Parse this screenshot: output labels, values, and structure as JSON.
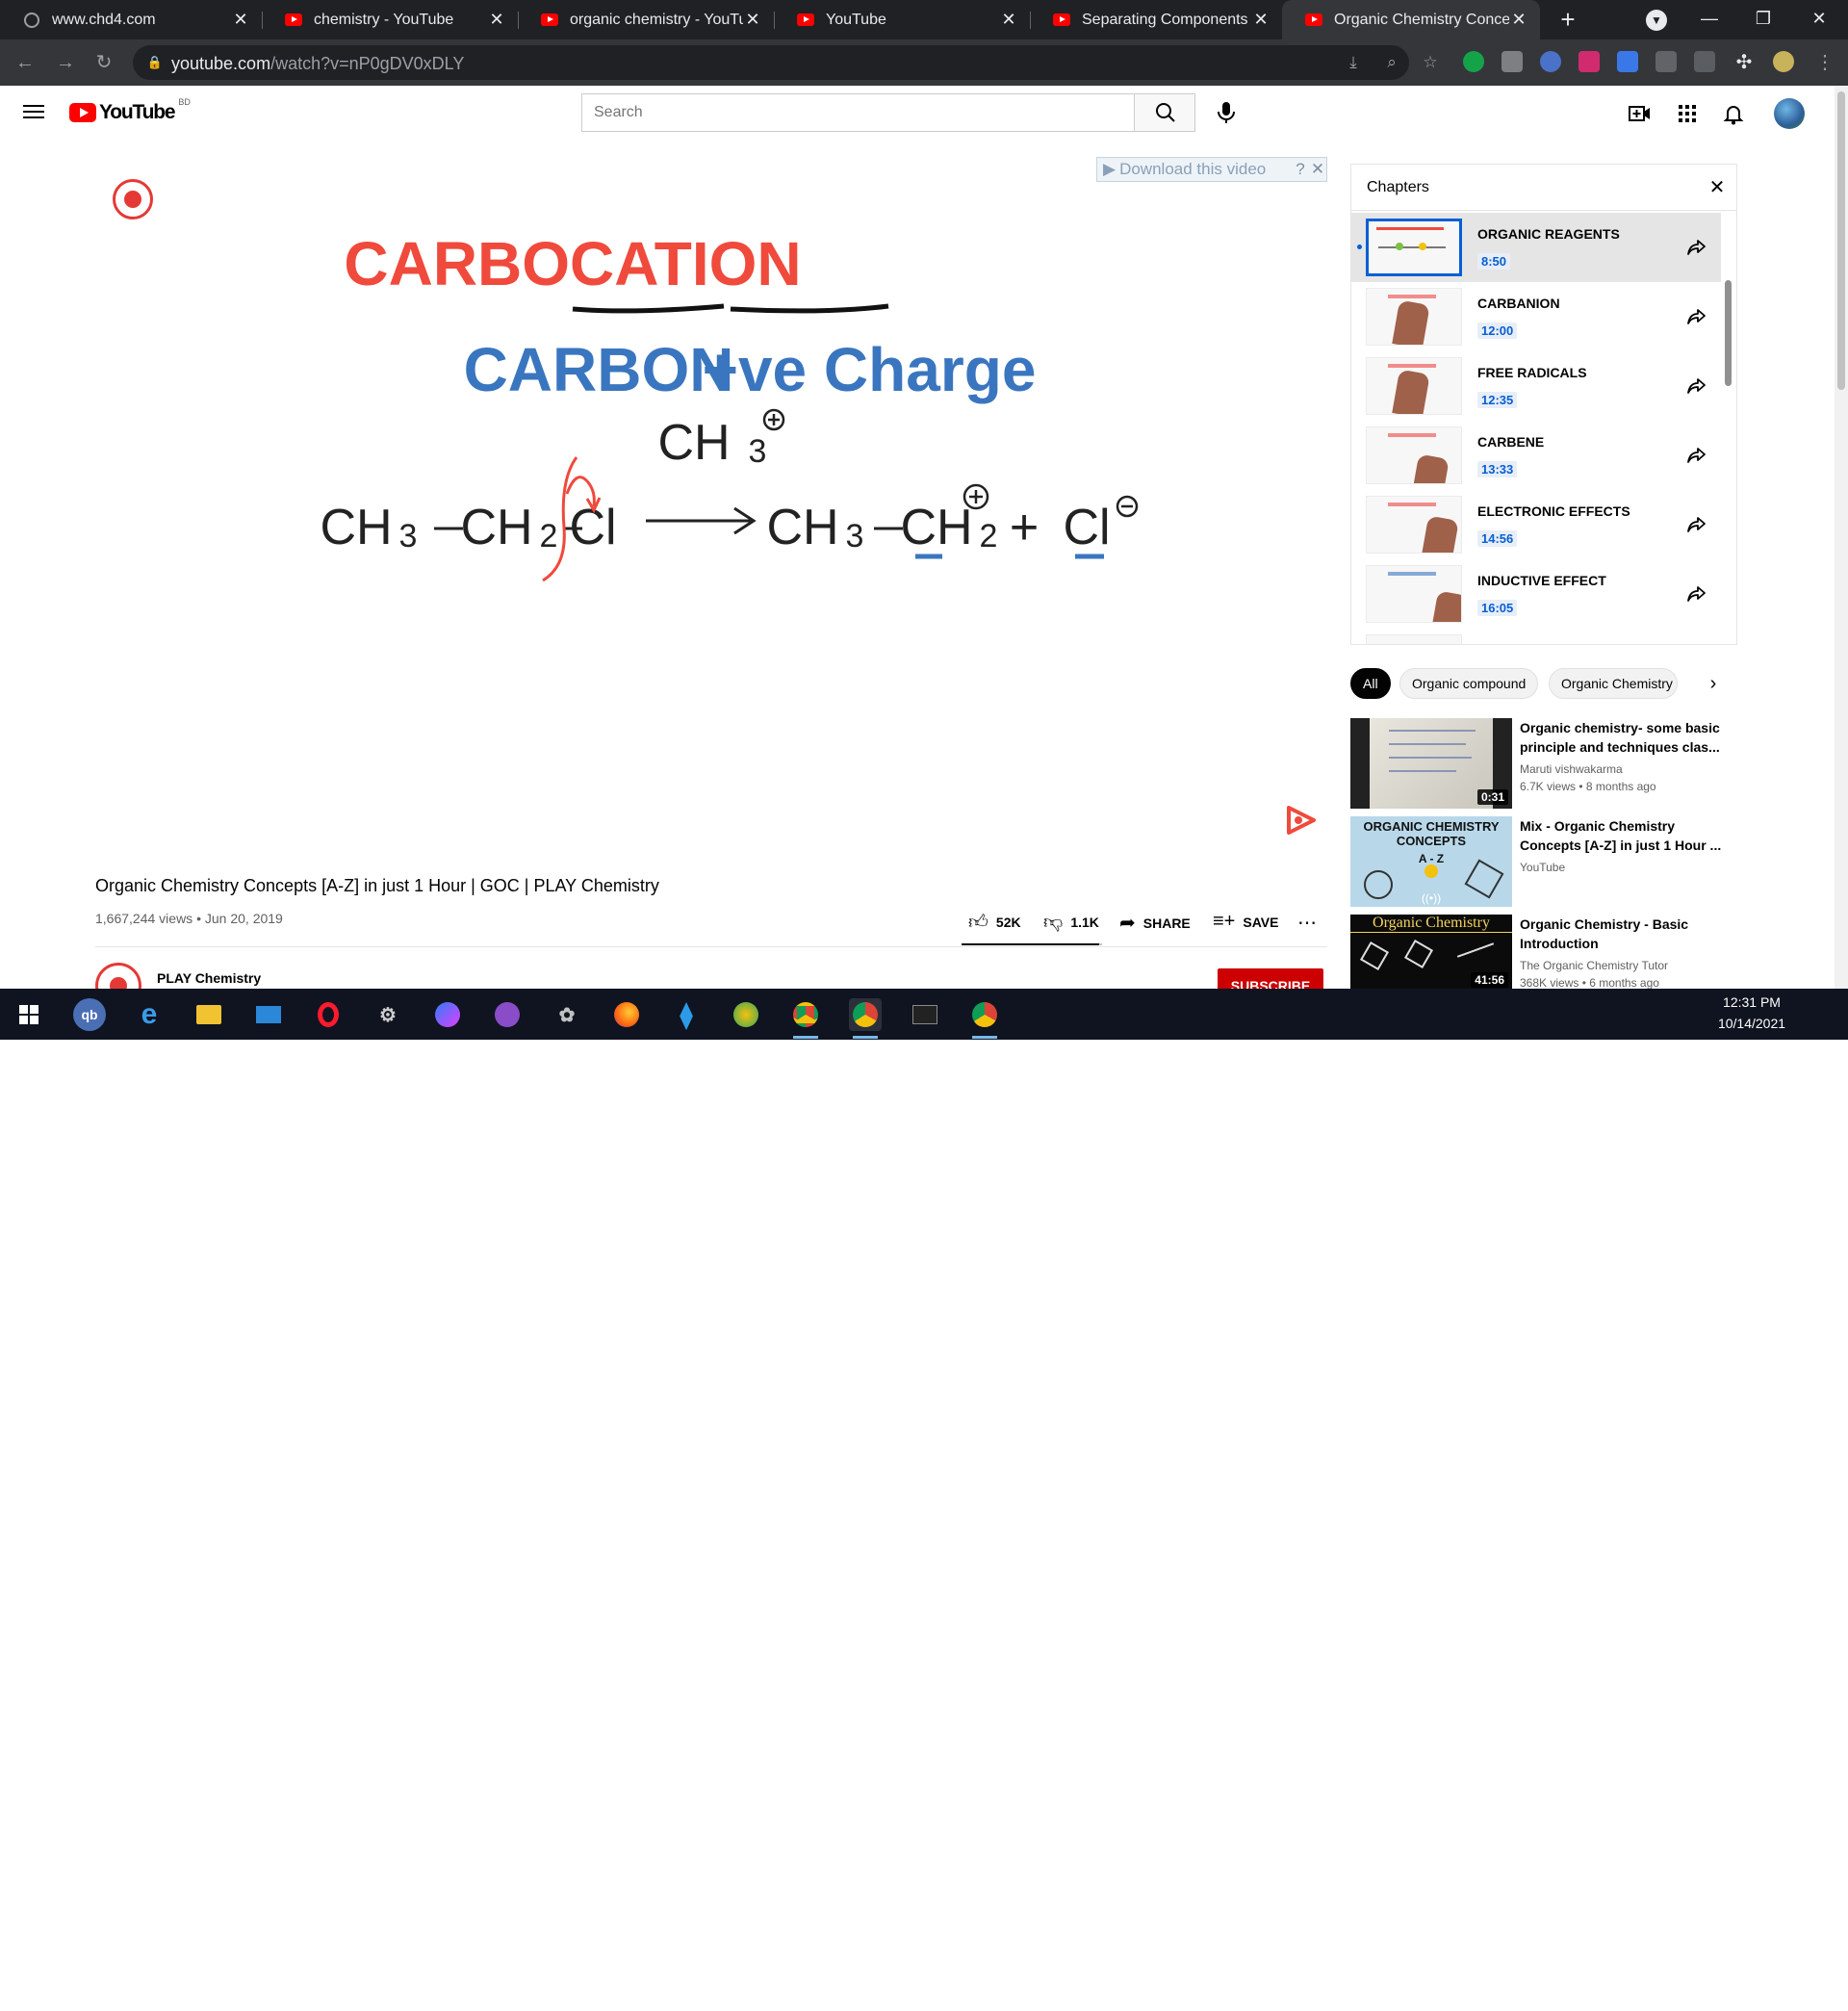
{
  "browser": {
    "tabs": [
      {
        "title": "www.chd4.com",
        "favicon": "globe-icon"
      },
      {
        "title": "chemistry - YouTube",
        "favicon": "youtube-icon"
      },
      {
        "title": "organic chemistry - YouTube",
        "favicon": "youtube-icon"
      },
      {
        "title": "YouTube",
        "favicon": "youtube-icon"
      },
      {
        "title": "Separating Components of",
        "favicon": "youtube-icon"
      },
      {
        "title": "Organic Chemistry Concept",
        "favicon": "youtube-icon",
        "active": true
      }
    ],
    "url_host": "youtube.com",
    "url_path": "/watch?v=nP0gDV0xDLY"
  },
  "youtube": {
    "logo_text": "YouTube",
    "country_code": "BD",
    "search_placeholder": "Search"
  },
  "player": {
    "download_bar": "Download this video",
    "slide": {
      "heading": "CARBOCATION",
      "sub_left": "CARBON",
      "sub_right": "+ve Charge",
      "methyl": "CH",
      "methyl_sub": "3",
      "reactant_1": "CH",
      "reactant_1_sub": "3",
      "reactant_2": "CH",
      "reactant_2_sub": "2",
      "leaving": "Cl",
      "product_1": "CH",
      "product_1_sub": "3",
      "product_2": "CH",
      "product_2_sub": "2",
      "plus": "+",
      "chloride": "Cl"
    }
  },
  "video": {
    "title": "Organic Chemistry Concepts [A-Z] in just 1 Hour | GOC | PLAY Chemistry",
    "views": "1,667,244 views",
    "date": "Jun 20, 2019",
    "likes": "52K",
    "dislikes": "1.1K",
    "share_label": "SHARE",
    "save_label": "SAVE",
    "like_ratio": 0.979,
    "channel": "PLAY Chemistry",
    "subscribe_label": "SUBSCRIBE"
  },
  "chapters": {
    "header": "Chapters",
    "items": [
      {
        "name": "ORGANIC REAGENTS",
        "time": "8:50",
        "active": true
      },
      {
        "name": "CARBANION",
        "time": "12:00"
      },
      {
        "name": "FREE RADICALS",
        "time": "12:35"
      },
      {
        "name": "CARBENE",
        "time": "13:33"
      },
      {
        "name": "ELECTRONIC EFFECTS",
        "time": "14:56"
      },
      {
        "name": "INDUCTIVE EFFECT",
        "time": "16:05"
      }
    ]
  },
  "chips": [
    "All",
    "Organic compound",
    "Organic Chemistry"
  ],
  "recommended": [
    {
      "title": "Organic chemistry- some basic principle and techniques clas...",
      "channel": "Maruti vishwakarma",
      "meta": "6.7K views • 8 months ago",
      "duration": "0:31"
    },
    {
      "title": "Mix - Organic Chemistry Concepts [A-Z] in just 1 Hour ...",
      "channel": "YouTube",
      "meta": "",
      "duration": "",
      "thumb_text": "ORGANIC CHEMISTRY CONCEPTS",
      "thumb_sub": "A - Z"
    },
    {
      "title": "Organic Chemistry - Basic Introduction",
      "channel": "The Organic Chemistry Tutor",
      "meta": "368K views • 6 months ago",
      "duration": "41:56",
      "thumb_text": "Organic Chemistry"
    }
  ],
  "taskbar": {
    "time": "12:31 PM",
    "date": "10/14/2021"
  }
}
